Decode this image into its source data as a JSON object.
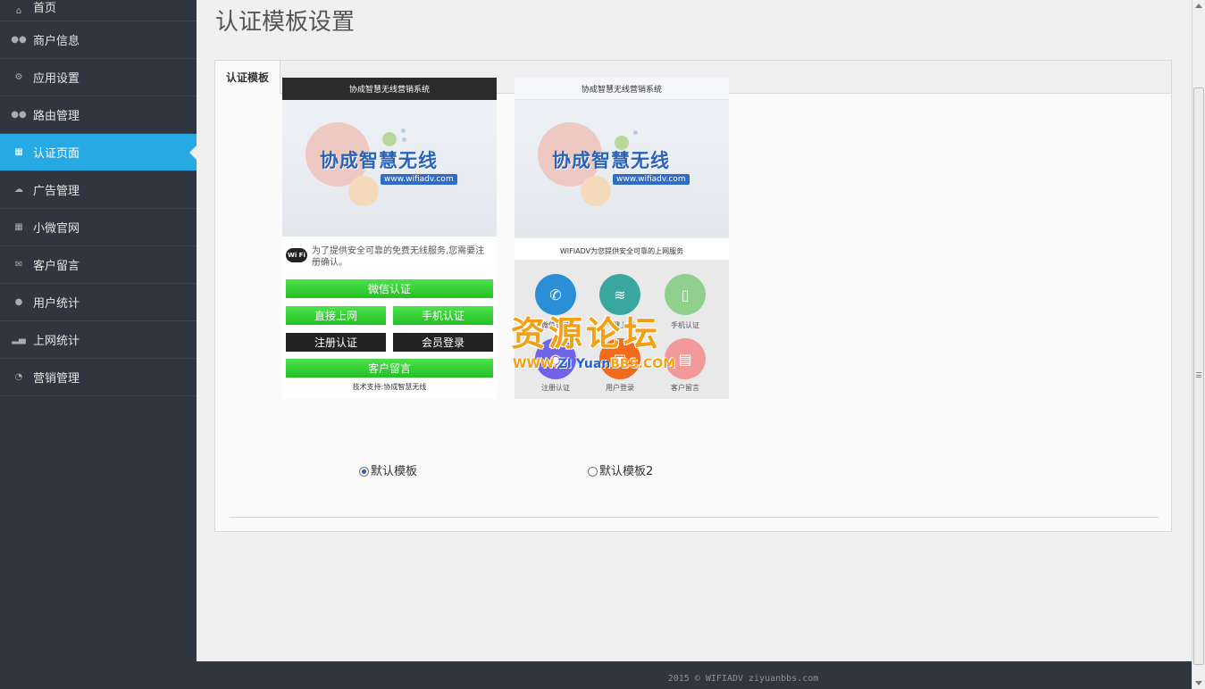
{
  "sidebar": {
    "items": [
      {
        "label": "首页",
        "icon": "home-icon"
      },
      {
        "label": "商户信息",
        "icon": "users-icon"
      },
      {
        "label": "应用设置",
        "icon": "cogs-icon"
      },
      {
        "label": "路由管理",
        "icon": "group-icon"
      },
      {
        "label": "认证页面",
        "icon": "table-icon",
        "active": true
      },
      {
        "label": "广告管理",
        "icon": "cloud-icon"
      },
      {
        "label": "小微官网",
        "icon": "grid-icon"
      },
      {
        "label": "客户留言",
        "icon": "envelope-icon"
      },
      {
        "label": "用户统计",
        "icon": "user-icon"
      },
      {
        "label": "上网统计",
        "icon": "signal-icon"
      },
      {
        "label": "营销管理",
        "icon": "dashboard-icon"
      }
    ]
  },
  "main": {
    "title": "认证模板设置",
    "tab_label": "认证模板"
  },
  "templates": {
    "t1": {
      "header": "协成智慧无线营销系统",
      "banner_text": "协成智慧无线",
      "banner_url": "www.wifiadv.com",
      "wifi_logo": "Wi Fi",
      "notice": "为了提供安全可靠的免费无线服务,您需要注册确认。",
      "btn_wechat": "微信认证",
      "btn_direct": "直接上网",
      "btn_phone": "手机认证",
      "btn_register": "注册认证",
      "btn_member": "会员登录",
      "btn_message": "客户留言",
      "support": "技术支持:协成智慧无线",
      "radio_label": "默认模板",
      "selected": true
    },
    "t2": {
      "header": "协成智慧无线营销系统",
      "banner_text": "协成智慧无线",
      "banner_url": "www.wifiadv.com",
      "slogan": "WIFIADV为您提供安全可靠的上网服务",
      "icon_labels": [
        "微信认证",
        "一键上网",
        "手机认证",
        "注册认证",
        "用户登录",
        "客户留言"
      ],
      "radio_label": "默认模板2",
      "selected": false
    }
  },
  "watermark": {
    "big": "资源论坛",
    "small_www": "WWW.",
    "small_zi": "ZI",
    "small_yuan": " Yuan",
    "small_bbs": "BBS",
    "small_com": ".COM"
  },
  "footer": {
    "text": "2015 © WIFIADV ziyuanbbs.com"
  },
  "colors": {
    "sidebar_bg": "#2f3640",
    "active_bg": "#27a9e3",
    "green_btn": "#2ecc2e",
    "watermark_orange": "#f2a117"
  }
}
